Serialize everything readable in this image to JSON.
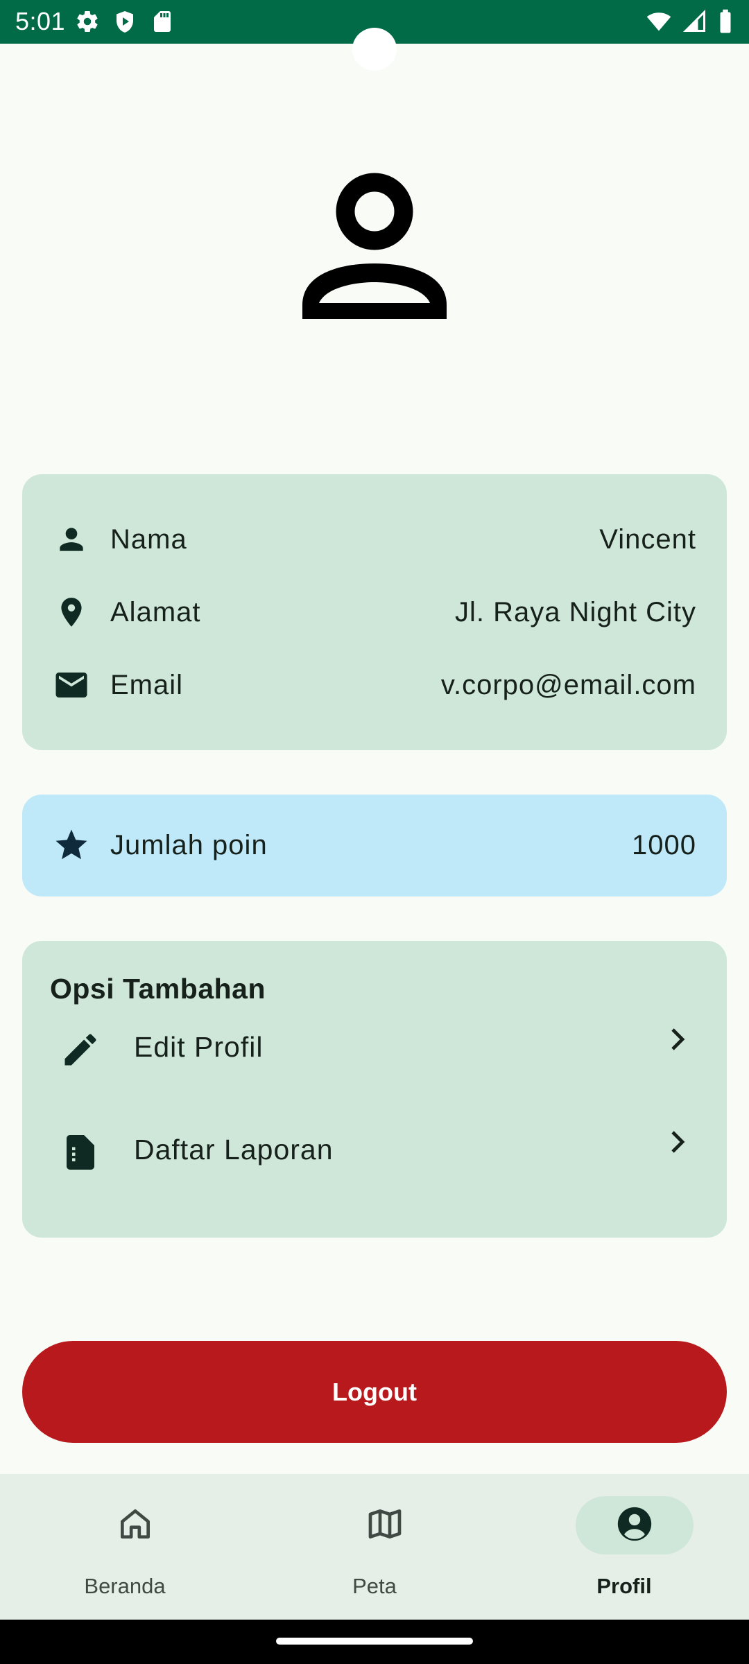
{
  "status_bar": {
    "time": "5:01",
    "left_icons": [
      "settings-icon",
      "shield-play-icon",
      "sd-card-icon"
    ],
    "right_icons": [
      "wifi-icon",
      "signal-icon",
      "battery-icon"
    ],
    "background_color": "#006b46"
  },
  "profile": {
    "avatar_icon": "person-outline-icon"
  },
  "info_card": {
    "rows": [
      {
        "icon": "person-icon",
        "label": "Nama",
        "value": "Vincent"
      },
      {
        "icon": "location-pin-icon",
        "label": "Alamat",
        "value": "Jl. Raya Night City"
      },
      {
        "icon": "mail-icon",
        "label": "Email",
        "value": "v.corpo@email.com"
      }
    ],
    "background_color": "#cfe7d9"
  },
  "points_card": {
    "icon": "star-icon",
    "label": "Jumlah poin",
    "value": "1000",
    "background_color": "#bfe8f8"
  },
  "options_card": {
    "title": "Opsi Tambahan",
    "items": [
      {
        "icon": "pencil-icon",
        "label": "Edit Profil"
      },
      {
        "icon": "document-icon",
        "label": "Daftar Laporan"
      }
    ]
  },
  "logout": {
    "label": "Logout",
    "color": "#b8191c"
  },
  "bottom_nav": {
    "items": [
      {
        "icon": "home-icon",
        "label": "Beranda",
        "active": false
      },
      {
        "icon": "map-icon",
        "label": "Peta",
        "active": false
      },
      {
        "icon": "account-circle-icon",
        "label": "Profil",
        "active": true
      }
    ]
  }
}
